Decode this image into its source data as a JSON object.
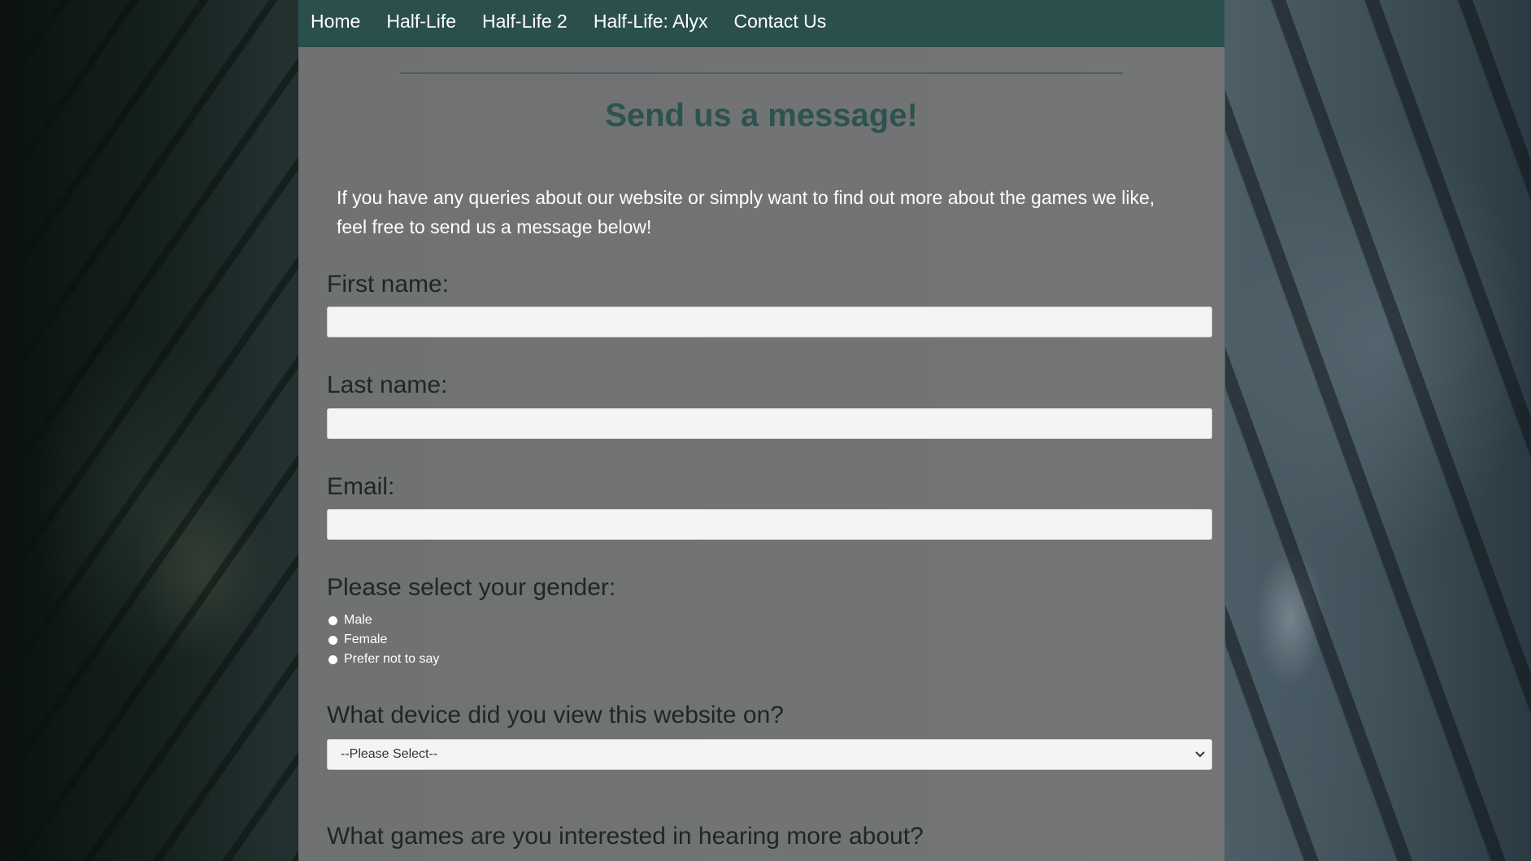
{
  "nav": {
    "items": [
      {
        "label": "Home"
      },
      {
        "label": "Half-Life"
      },
      {
        "label": "Half-Life 2"
      },
      {
        "label": "Half-Life: Alyx"
      },
      {
        "label": "Contact Us"
      }
    ]
  },
  "main": {
    "title": "Send us a message!",
    "intro": "If you have any queries about our website or simply want to find out more about the games we like, feel free to send us a message below!"
  },
  "form": {
    "first_name": {
      "label": "First name:",
      "value": "",
      "placeholder": ""
    },
    "last_name": {
      "label": "Last name:",
      "value": "",
      "placeholder": ""
    },
    "email": {
      "label": "Email:",
      "value": "",
      "placeholder": ""
    },
    "gender": {
      "label": "Please select your gender:",
      "options": [
        "Male",
        "Female",
        "Prefer not to say"
      ]
    },
    "device": {
      "label": "What device did you view this website on?",
      "selected": "--Please Select--"
    },
    "games": {
      "label": "What games are you interested in hearing more about?"
    }
  },
  "colors": {
    "nav_background": "#2b4f4c",
    "title": "#2c5350",
    "content_panel": "#767676"
  }
}
